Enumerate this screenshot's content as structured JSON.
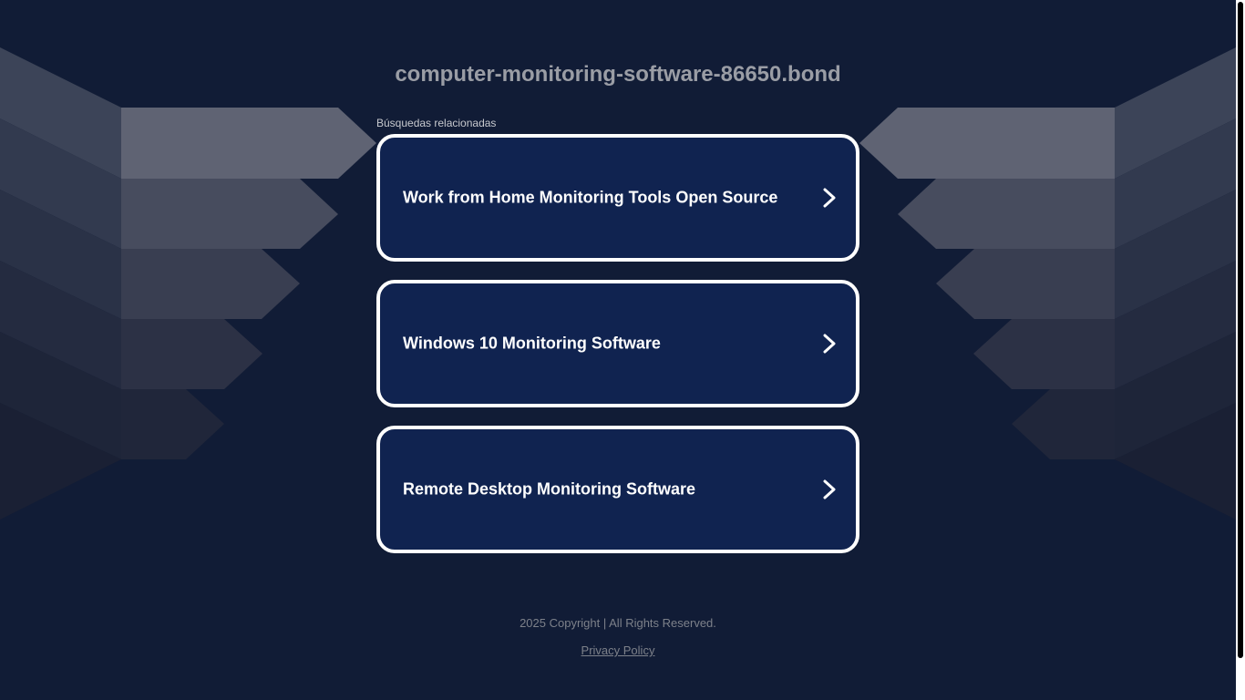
{
  "header": {
    "domain": "computer-monitoring-software-86650.bond"
  },
  "related": {
    "label": "Búsquedas relacionadas",
    "items": [
      {
        "label": "Work from Home Monitoring Tools Open Source"
      },
      {
        "label": "Windows 10 Monitoring Software"
      },
      {
        "label": "Remote Desktop Monitoring Software"
      }
    ]
  },
  "footer": {
    "copyright": "2025 Copyright | All Rights Reserved.",
    "privacy": "Privacy Policy"
  },
  "colors": {
    "background": "#111c36",
    "card": "#102350",
    "card_border": "#ffffff",
    "title": "#9a9da5"
  },
  "icons": {
    "card_arrow": "chevron-right-icon"
  }
}
